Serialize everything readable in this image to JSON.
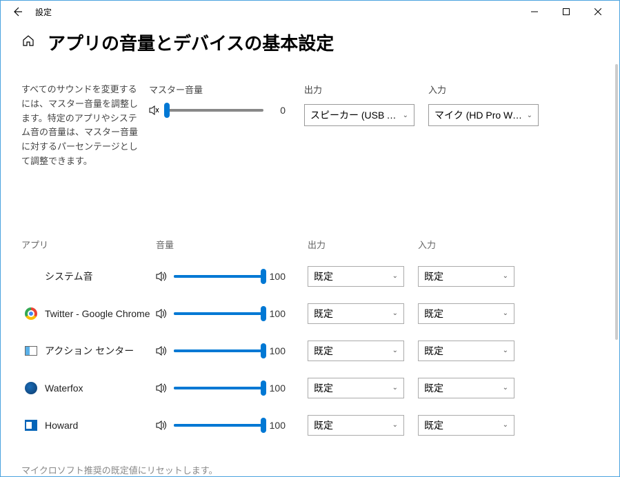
{
  "window": {
    "title": "設定"
  },
  "page": {
    "title": "アプリの音量とデバイスの基本設定"
  },
  "description": "すべてのサウンドを変更するには、マスター音量を調整します。特定のアプリやシステム音の音量は、マスター音量に対するパーセンテージとして調整できます。",
  "labels": {
    "master_volume": "マスター音量",
    "output": "出力",
    "input": "入力",
    "apps": "アプリ",
    "volume": "音量",
    "default": "既定"
  },
  "master": {
    "volume": 0,
    "output": "スピーカー (USB Audi...",
    "input": "マイク (HD Pro Web..."
  },
  "apps": [
    {
      "icon": "none",
      "name": "システム音",
      "volume": 100,
      "output": "既定",
      "input": "既定"
    },
    {
      "icon": "chrome",
      "name": "Twitter - Google Chrome",
      "volume": 100,
      "output": "既定",
      "input": "既定"
    },
    {
      "icon": "action",
      "name": "アクション センター",
      "volume": 100,
      "output": "既定",
      "input": "既定"
    },
    {
      "icon": "waterfox",
      "name": "Waterfox",
      "volume": 100,
      "output": "既定",
      "input": "既定"
    },
    {
      "icon": "outlook",
      "name": "Howard",
      "volume": 100,
      "output": "既定",
      "input": "既定"
    }
  ],
  "footer": "マイクロソフト推奨の既定値にリセットします。"
}
